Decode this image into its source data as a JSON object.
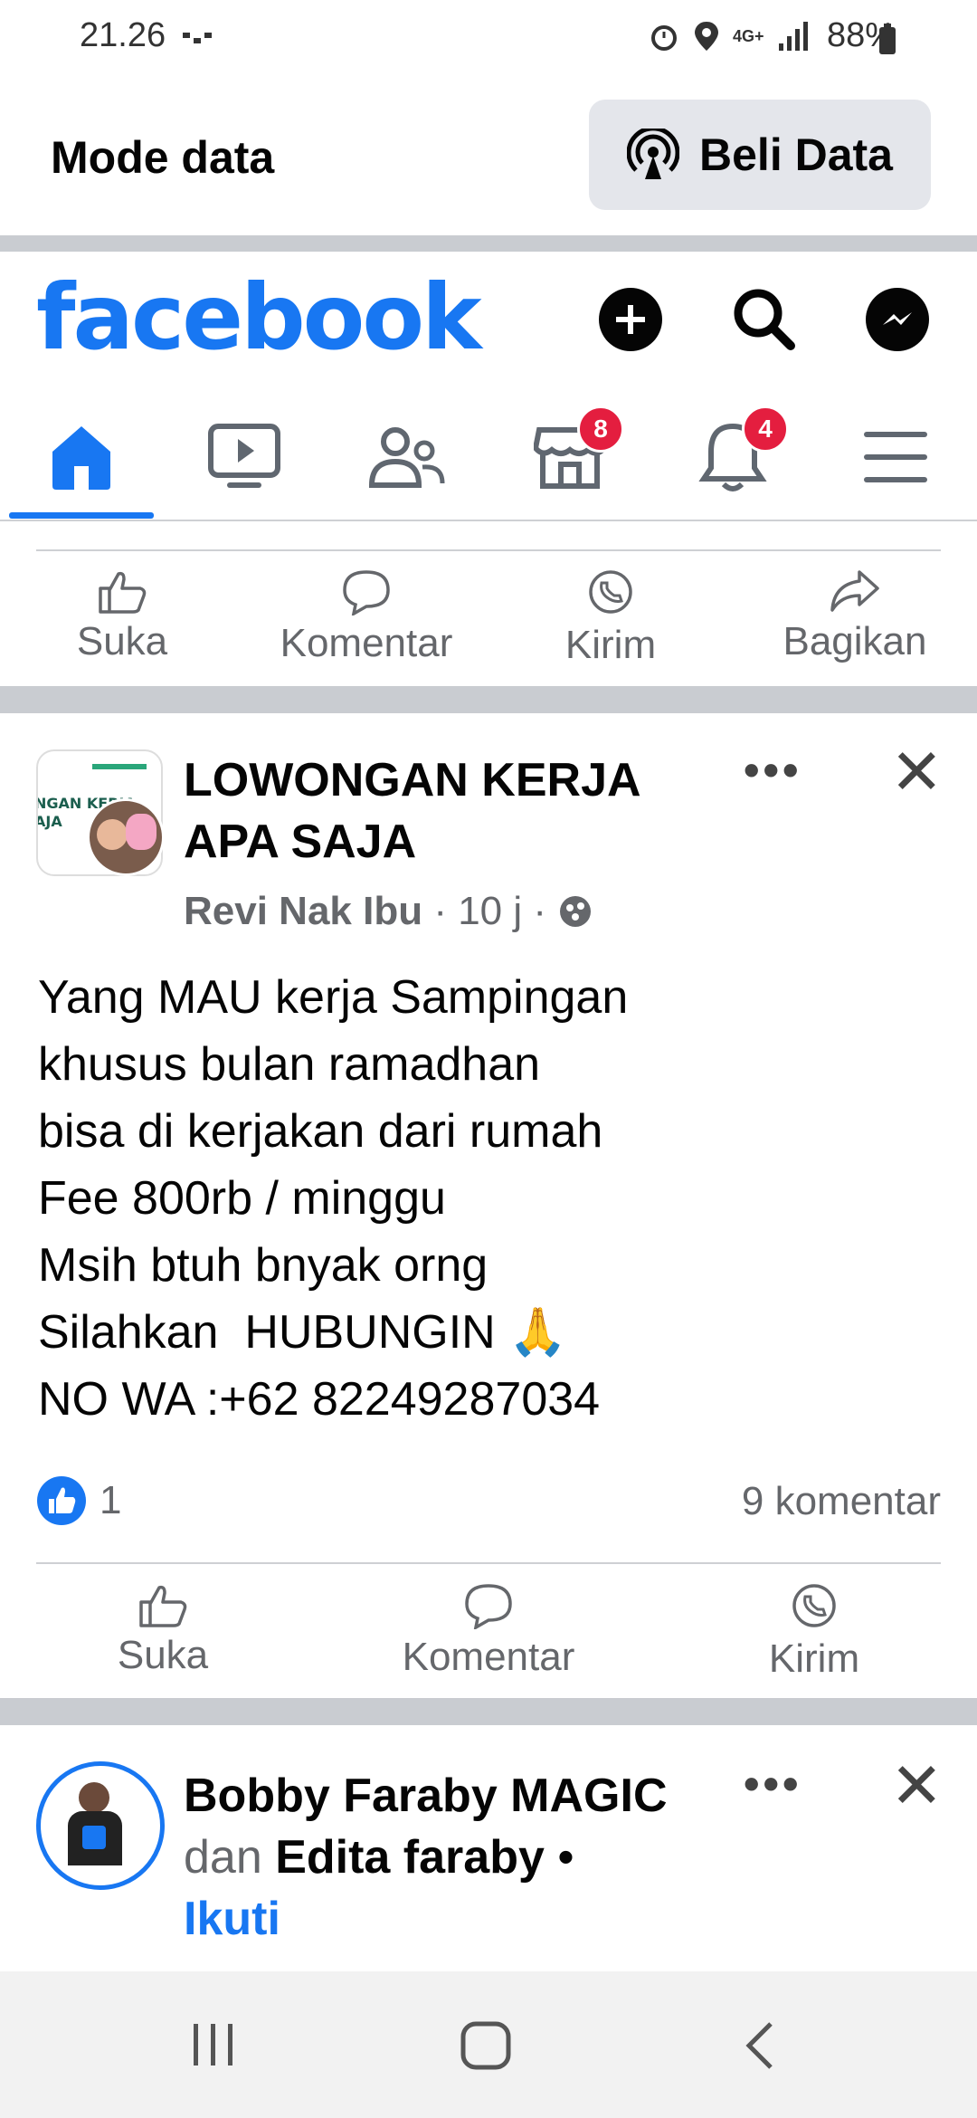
{
  "status_bar": {
    "time": "21.26",
    "battery": "88%",
    "network": "4G+"
  },
  "data_bar": {
    "mode_label": "Mode data",
    "buy_data_label": "Beli Data"
  },
  "header": {
    "logo": "facebook"
  },
  "nav_tabs": {
    "marketplace_badge": "8",
    "notifications_badge": "4"
  },
  "top_actions": [
    "Suka",
    "Komentar",
    "Kirim",
    "Bagikan"
  ],
  "post": {
    "group_name_line1": "LOWONGAN KERJA",
    "group_name_line2": "APA SAJA",
    "group_thumb_text": "NGAN KERJA\nAJA",
    "author": "Revi Nak Ibu",
    "time": " · 10 j · ",
    "body_lines": [
      "Yang MAU kerja Sampingan",
      "khusus bulan ramadhan",
      "bisa di kerjakan dari rumah",
      "Fee 800rb / minggu",
      "Msih btuh bnyak orng",
      "Silahkan  HUBUNGIN 🙏",
      "NO WA :+62 82249287034"
    ],
    "like_count": "1",
    "comment_count": "9 komentar",
    "actions": [
      "Suka",
      "Komentar",
      "Kirim"
    ]
  },
  "next_post": {
    "author": "Bobby Faraby MAGIC",
    "connector": "dan ",
    "coauthor": "Edita faraby",
    "dot": " •",
    "follow": "Ikuti"
  },
  "icons": [
    "data-icon",
    "plus-icon",
    "search-icon",
    "messenger-icon",
    "home-icon",
    "video-icon",
    "friends-icon",
    "marketplace-icon",
    "bell-icon",
    "menu-icon",
    "like-icon",
    "comment-icon",
    "whatsapp-icon",
    "share-icon",
    "globe-icon",
    "like-reaction-icon",
    "recent-apps-icon",
    "home-nav-icon",
    "back-icon"
  ],
  "colors": {
    "brand": "#1877f2",
    "badge": "#e41e3f",
    "text_secondary": "#65676b"
  }
}
